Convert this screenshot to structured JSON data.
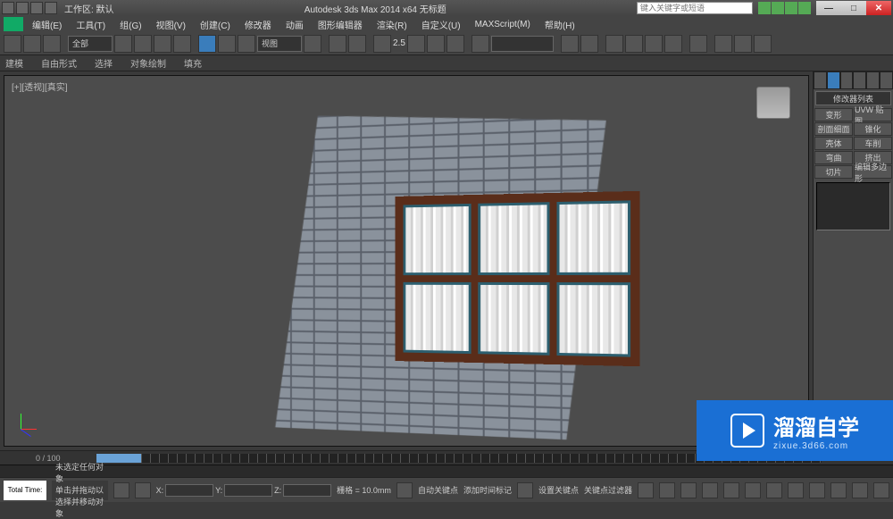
{
  "title_bar": {
    "workspace_label": "工作区: 默认",
    "app_title": "Autodesk 3ds Max 2014 x64   无标题",
    "search_placeholder": "键入关键字或短语"
  },
  "menus": [
    "编辑(E)",
    "工具(T)",
    "组(G)",
    "视图(V)",
    "创建(C)",
    "修改器",
    "动画",
    "图形编辑器",
    "渲染(R)",
    "自定义(U)",
    "MAXScript(M)",
    "帮助(H)"
  ],
  "subtoolbar": {
    "a": "建模",
    "b": "自由形式",
    "c": "选择",
    "d": "对象绘制",
    "e": "填充"
  },
  "viewport": {
    "label": "[+][透视][真实]"
  },
  "toolbar_combo_all": "全部",
  "toolbar_combo_view": "视图",
  "toolbar_val": "2.5",
  "right_panel": {
    "modlist_label": "修改器列表",
    "rows": [
      [
        "变形",
        "UVW 贴图"
      ],
      [
        "剖面细面",
        "锥化"
      ],
      [
        "壳体",
        "车削"
      ],
      [
        "弯曲",
        "挤出"
      ],
      [
        "切片",
        "编辑多边形"
      ]
    ]
  },
  "timeline": {
    "frame_label": "0 / 100"
  },
  "status": {
    "total_time_label": "Total Time:",
    "prompt1": "未选定任何对象",
    "prompt2": "单击并拖动以选择并移动对象",
    "x": "",
    "y": "",
    "z": "",
    "grid_label": "栅格 = 10.0mm",
    "autokey": "自动关键点",
    "setkey_label": "设置关键点",
    "keyfilter_label": "关键点过滤器",
    "addtimetag": "添加时间标记"
  },
  "watermark": {
    "brand": "溜溜自学",
    "url": "zixue.3d66.com"
  }
}
